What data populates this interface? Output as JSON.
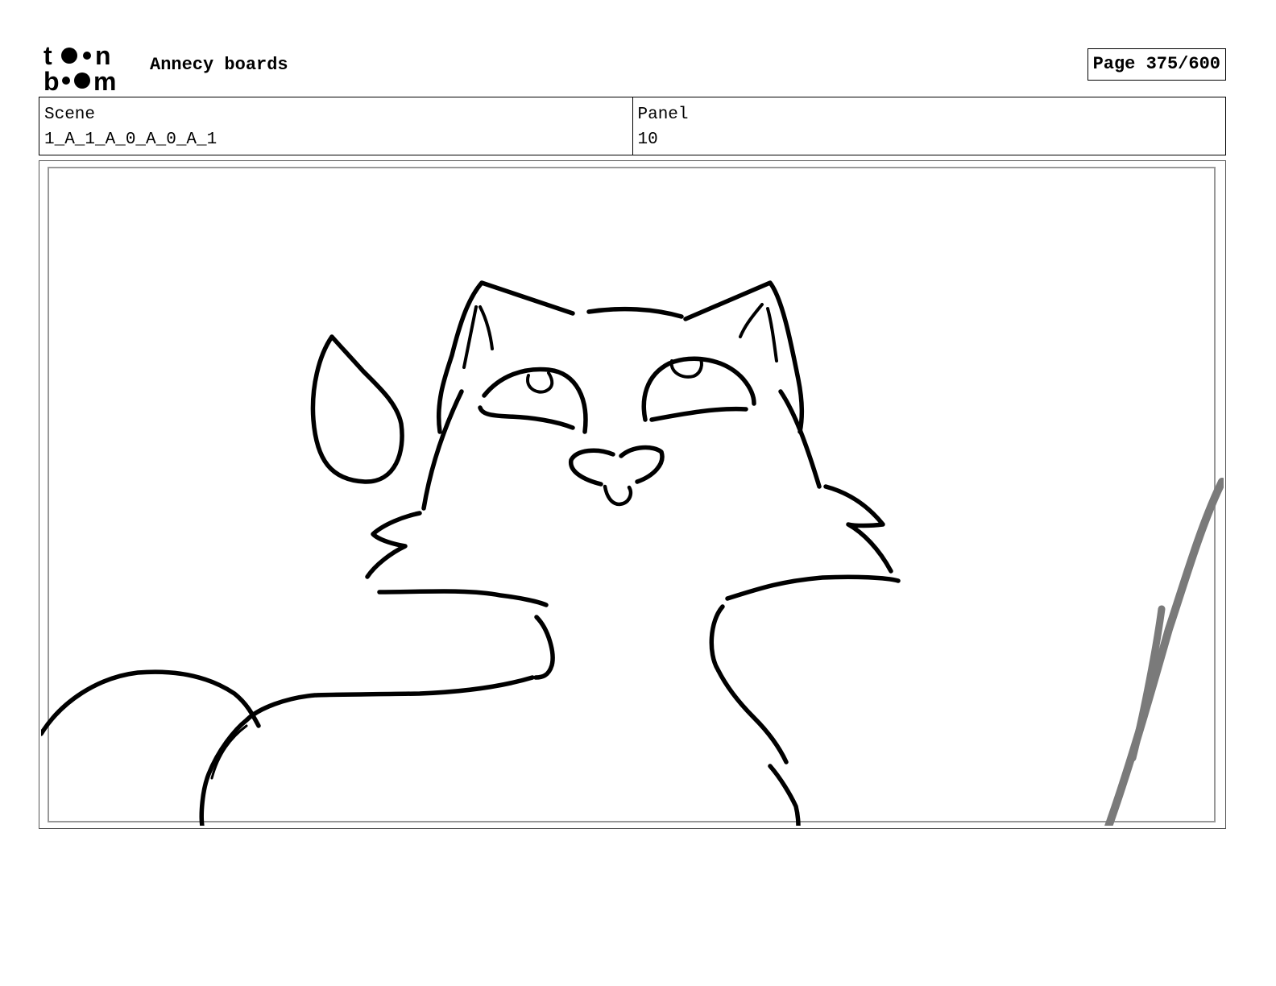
{
  "header": {
    "logo_line1": "toon",
    "logo_line2": "boom",
    "project_title": "Annecy boards",
    "page_counter": "Page 375/600"
  },
  "scene": {
    "label": "Scene",
    "value": "1_A_1_A_0_A_0_A_1"
  },
  "panel": {
    "label": "Panel",
    "value": "10"
  },
  "drawing": {
    "subject": "cat-sketch",
    "stroke_color": "#000000",
    "pencil_color": "#7a7a7a"
  }
}
